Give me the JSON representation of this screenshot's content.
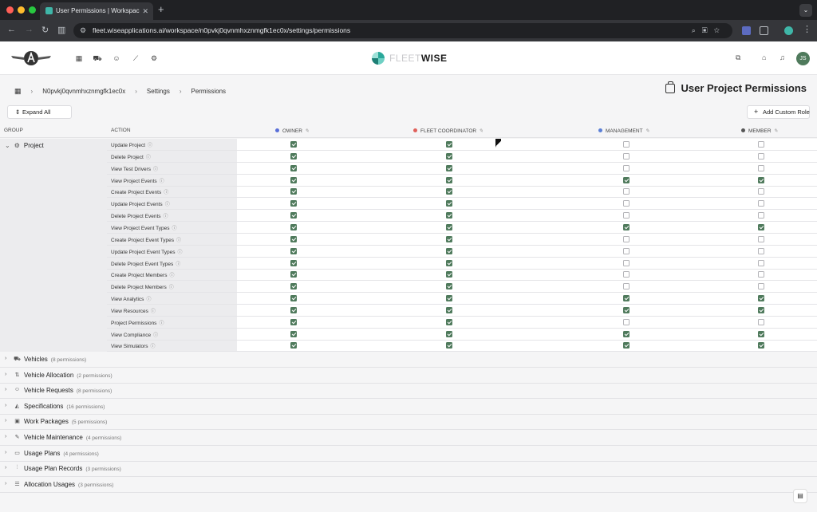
{
  "browser": {
    "tab_title": "User Permissions | Workspac",
    "url": "fleet.wiseapplications.ai/workspace/n0pvkj0qvnmhxznmgfk1ec0x/settings/permissions",
    "colors": {
      "close": "#ff5f57",
      "minimize": "#febc2e",
      "zoom": "#28c840"
    }
  },
  "header": {
    "brand_thin": "FLEET",
    "brand_bold": "WISE",
    "avatar_initials": "JS",
    "icons": [
      "home-icon",
      "bell-icon",
      "external-icon"
    ]
  },
  "breadcrumb": {
    "workspace": "N0pvkj0qvnmhxznmgfk1ec0x",
    "settings": "Settings",
    "permissions": "Permissions"
  },
  "page_title": "User Project Permissions",
  "toolbar": {
    "expand_all": "Expand All",
    "add_custom_role": "Add Custom Role"
  },
  "table": {
    "col_group": "GROUP",
    "col_action": "ACTION",
    "roles": [
      {
        "name": "OWNER",
        "color": "#5a6fd8"
      },
      {
        "name": "FLEET COORDINATOR",
        "color": "#e0605a"
      },
      {
        "name": "MANAGEMENT",
        "color": "#5b7fd6"
      },
      {
        "name": "MEMBER",
        "color": "#555555"
      }
    ],
    "project_group": "Project",
    "project_rows": [
      {
        "action": "Update Project",
        "checks": [
          true,
          true,
          false,
          false
        ]
      },
      {
        "action": "Delete Project",
        "checks": [
          true,
          true,
          false,
          false
        ]
      },
      {
        "action": "View Test Drivers",
        "checks": [
          true,
          true,
          false,
          false
        ]
      },
      {
        "action": "View Project Events",
        "checks": [
          true,
          true,
          true,
          true
        ]
      },
      {
        "action": "Create Project Events",
        "checks": [
          true,
          true,
          false,
          false
        ]
      },
      {
        "action": "Update Project Events",
        "checks": [
          true,
          true,
          false,
          false
        ]
      },
      {
        "action": "Delete Project Events",
        "checks": [
          true,
          true,
          false,
          false
        ]
      },
      {
        "action": "View Project Event Types",
        "checks": [
          true,
          true,
          true,
          true
        ]
      },
      {
        "action": "Create Project Event Types",
        "checks": [
          true,
          true,
          false,
          false
        ]
      },
      {
        "action": "Update Project Event Types",
        "checks": [
          true,
          true,
          false,
          false
        ]
      },
      {
        "action": "Delete Project Event Types",
        "checks": [
          true,
          true,
          false,
          false
        ]
      },
      {
        "action": "Create Project Members",
        "checks": [
          true,
          true,
          false,
          false
        ]
      },
      {
        "action": "Delete Project Members",
        "checks": [
          true,
          true,
          false,
          false
        ]
      },
      {
        "action": "View Analytics",
        "checks": [
          true,
          true,
          true,
          true
        ]
      },
      {
        "action": "View Resources",
        "checks": [
          true,
          true,
          true,
          true
        ]
      },
      {
        "action": "Project Permissions",
        "checks": [
          true,
          true,
          false,
          false
        ]
      },
      {
        "action": "View Compliance",
        "checks": [
          true,
          true,
          true,
          true
        ]
      },
      {
        "action": "View Simulators",
        "checks": [
          true,
          true,
          true,
          true
        ]
      }
    ],
    "collapsed_groups": [
      {
        "name": "Vehicles",
        "count": "(8 permissions)",
        "icon": "car-icon"
      },
      {
        "name": "Vehicle Allocation",
        "count": "(2 permissions)",
        "icon": "allocation-icon"
      },
      {
        "name": "Vehicle Requests",
        "count": "(8 permissions)",
        "icon": "users-icon"
      },
      {
        "name": "Specifications",
        "count": "(16 permissions)",
        "icon": "shapes-icon"
      },
      {
        "name": "Work Packages",
        "count": "(5 permissions)",
        "icon": "package-icon"
      },
      {
        "name": "Vehicle Maintenance",
        "count": "(4 permissions)",
        "icon": "wrench-icon"
      },
      {
        "name": "Usage Plans",
        "count": "(4 permissions)",
        "icon": "calendar-icon"
      },
      {
        "name": "Usage Plan Records",
        "count": "(3 permissions)",
        "icon": "chart-icon"
      },
      {
        "name": "Allocation Usages",
        "count": "(3 permissions)",
        "icon": "list-icon"
      }
    ]
  }
}
